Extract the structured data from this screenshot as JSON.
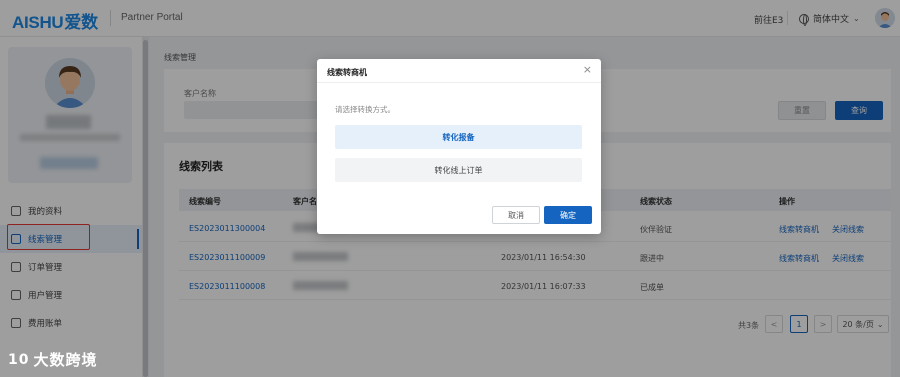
{
  "header": {
    "logo_latin": "AISHU",
    "logo_cn": "爱数",
    "portal_title": "Partner Portal",
    "goto_link": "前往E3",
    "language": "简体中文"
  },
  "sidebar": {
    "items": [
      {
        "label": "我的资料"
      },
      {
        "label": "线索管理"
      },
      {
        "label": "订单管理"
      },
      {
        "label": "用户管理"
      },
      {
        "label": "费用账单"
      }
    ]
  },
  "breadcrumb": "线索管理",
  "filter": {
    "customer_label": "客户名称",
    "reset_label": "重置",
    "query_label": "查询"
  },
  "list": {
    "title": "线索列表",
    "columns": [
      "线索编号",
      "客户名",
      "线索状态",
      "操作"
    ],
    "rows": [
      {
        "id": "ES2023011300004",
        "time": "",
        "status": "伙伴验证",
        "action1": "线索转商机",
        "action2": "关闭线索"
      },
      {
        "id": "ES2023011100009",
        "time": "2023/01/11 16:54:30",
        "status": "跟进中",
        "action1": "线索转商机",
        "action2": "关闭线索"
      },
      {
        "id": "ES2023011100008",
        "time": "2023/01/11 16:07:33",
        "status": "已成单",
        "action1": "",
        "action2": ""
      }
    ]
  },
  "pagination": {
    "total": "共3条",
    "prev": "<",
    "current": "1",
    "next": ">",
    "page_size": "20 条/页"
  },
  "modal": {
    "title": "线索转商机",
    "close": "×",
    "hint": "请选择转换方式。",
    "option1": "转化报备",
    "option2": "转化线上订单",
    "cancel": "取消",
    "confirm": "确定"
  },
  "watermark": {
    "logo": "10",
    "text": "大数跨境"
  },
  "colors": {
    "accent": "#1565c0",
    "highlight_border": "#e53935"
  }
}
